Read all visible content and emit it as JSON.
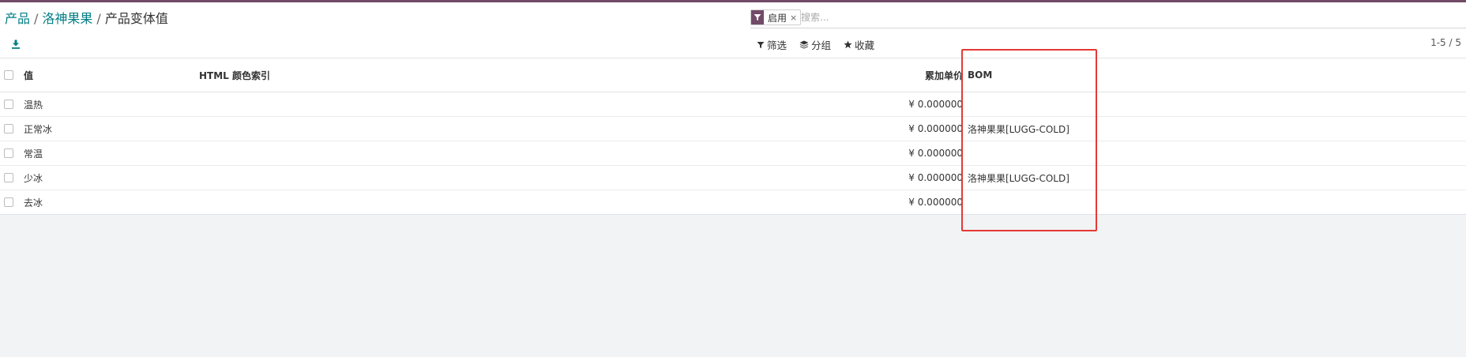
{
  "breadcrumb": {
    "items": [
      {
        "label": "产品"
      },
      {
        "label": "洛神果果"
      },
      {
        "label": "产品变体值"
      }
    ],
    "separator": "/"
  },
  "search": {
    "facet_label": "启用",
    "facet_remove": "×",
    "placeholder": "搜索..."
  },
  "toolbar": {
    "filter_label": "筛选",
    "group_label": "分组",
    "favorite_label": "收藏"
  },
  "pager": {
    "text": "1-5 / 5"
  },
  "table": {
    "columns": {
      "value": "值",
      "html_color": "HTML 颜色索引",
      "extra_price": "累加单价",
      "bom": "BOM"
    },
    "rows": [
      {
        "value": "温热",
        "html_color": "",
        "extra_price": "¥ 0.000000",
        "bom": ""
      },
      {
        "value": "正常冰",
        "html_color": "",
        "extra_price": "¥ 0.000000",
        "bom": "洛神果果[LUGG-COLD]"
      },
      {
        "value": "常温",
        "html_color": "",
        "extra_price": "¥ 0.000000",
        "bom": ""
      },
      {
        "value": "少冰",
        "html_color": "",
        "extra_price": "¥ 0.000000",
        "bom": "洛神果果[LUGG-COLD]"
      },
      {
        "value": "去冰",
        "html_color": "",
        "extra_price": "¥ 0.000000",
        "bom": ""
      }
    ]
  },
  "colors": {
    "brand": "#714b67",
    "link": "#017e84",
    "highlight": "#e53935"
  },
  "icons": {
    "download": "download-icon",
    "filter": "filter-icon",
    "group": "layers-icon",
    "favorite": "star-icon",
    "facet": "filter-icon"
  }
}
